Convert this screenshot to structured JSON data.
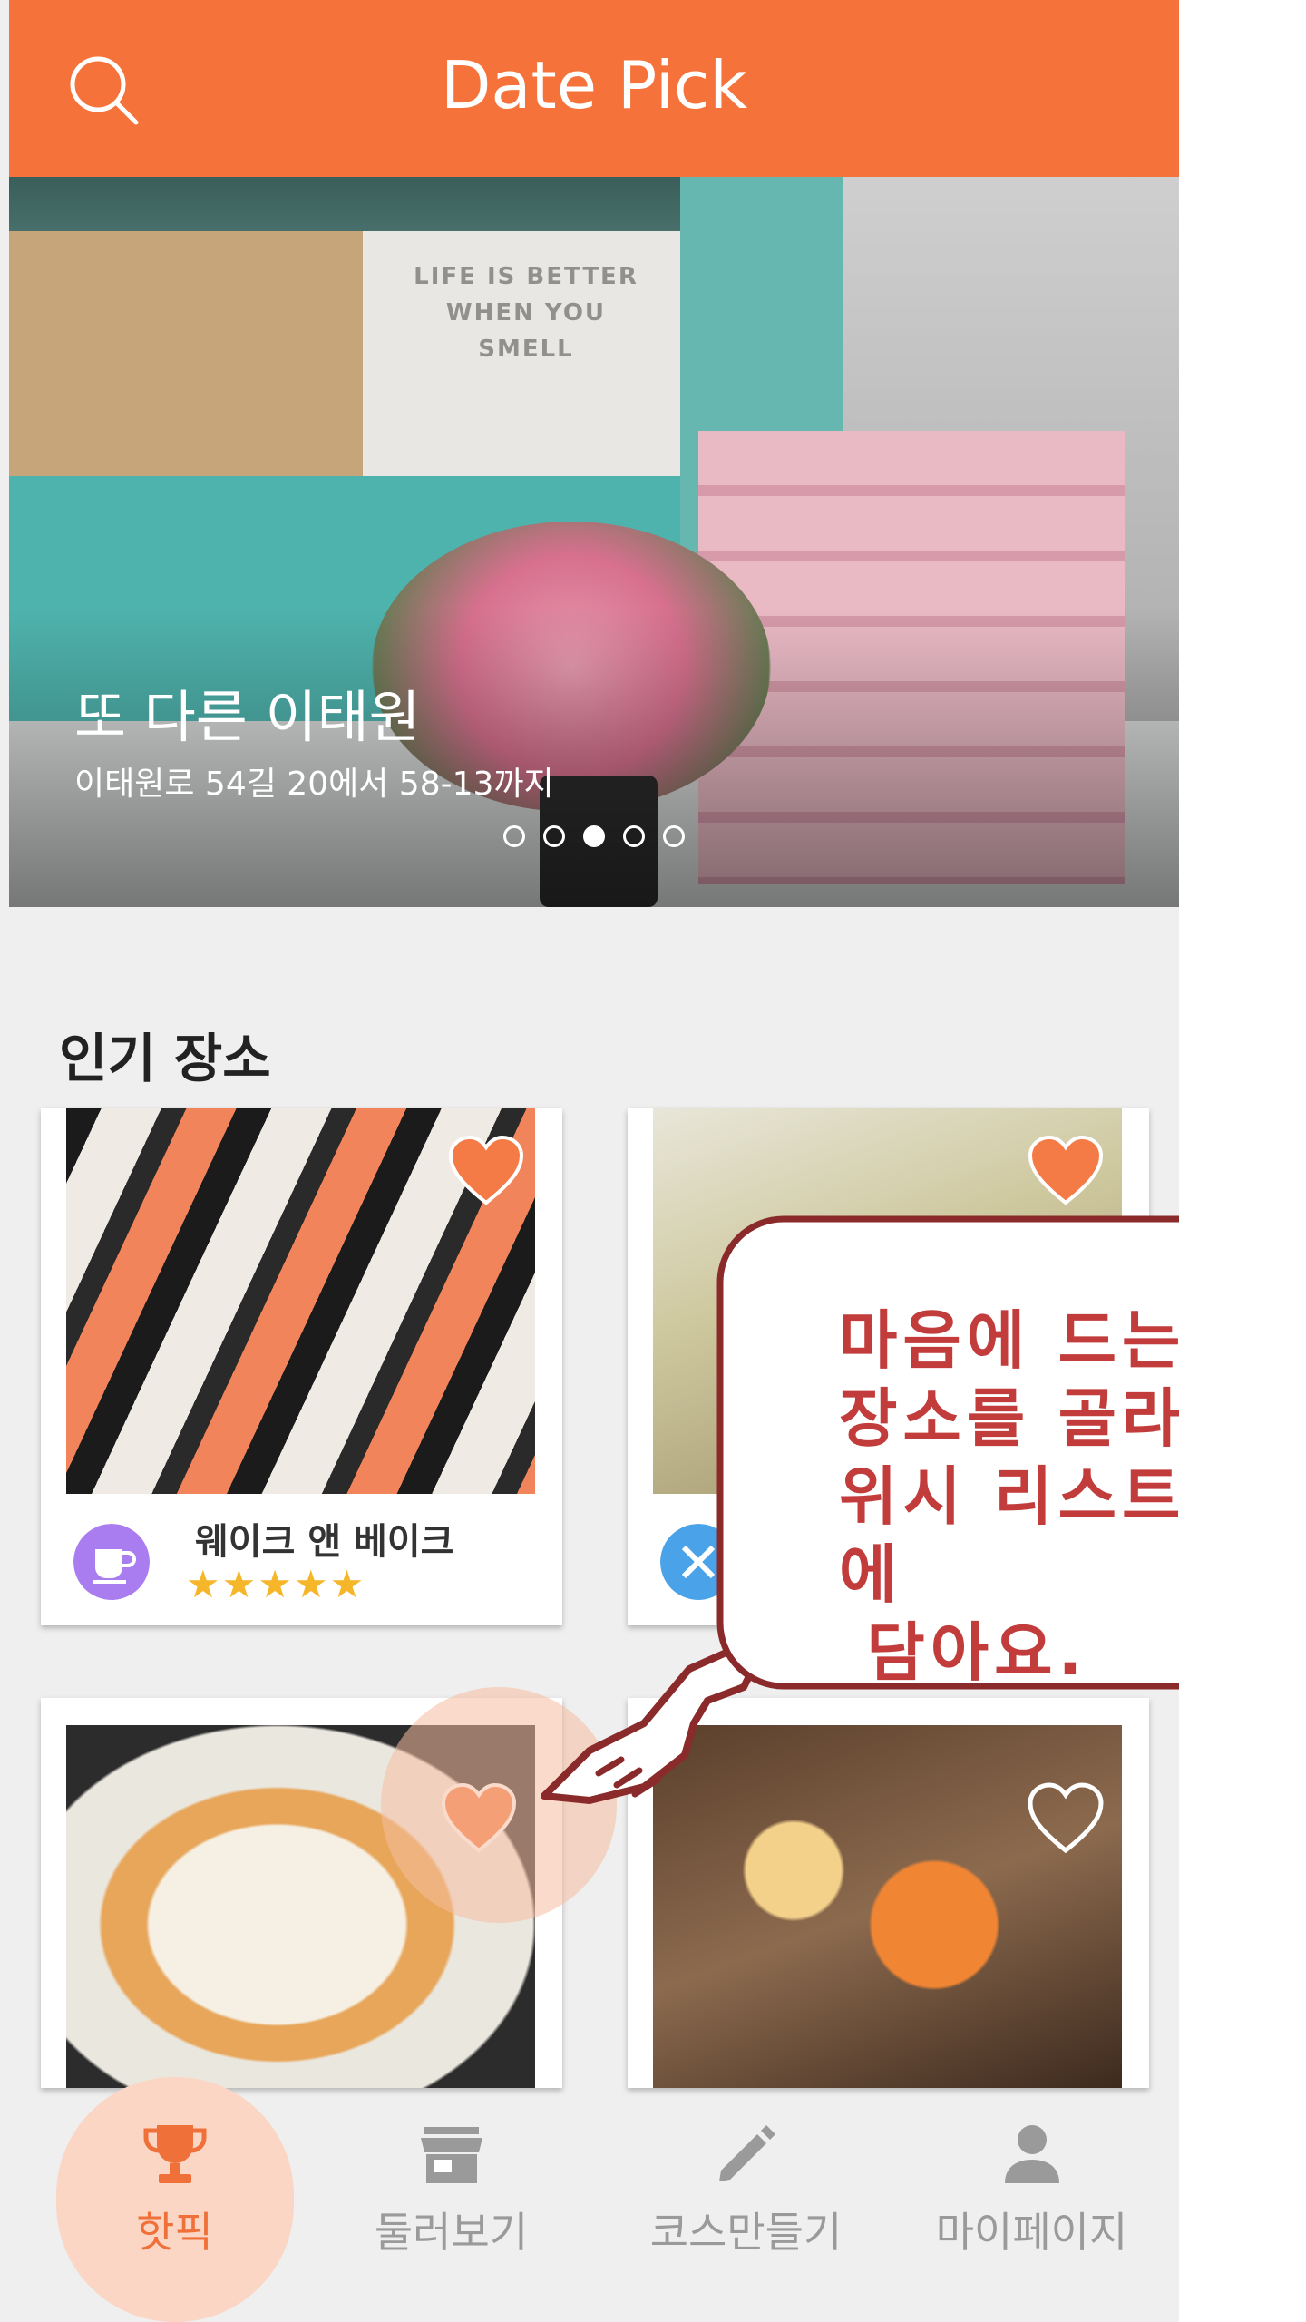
{
  "colors": {
    "primary": "#f5723b",
    "heart": "#f47a46",
    "callout_text": "#c23c3c",
    "callout_border": "#8b2a2a",
    "star": "#f6b62a",
    "nav_active_bg": "#fbd6c5"
  },
  "header": {
    "title": "Date Pick",
    "search_icon": "search-icon"
  },
  "hero": {
    "title": "또 다른 이태원",
    "subtitle": "이태원로 54길 20에서 58-13까지",
    "wordart": "LIFE IS BETTER WHEN YOU SMELL",
    "carousel": {
      "count": 5,
      "active_index": 3
    }
  },
  "popular": {
    "title": "인기 장소",
    "cards": [
      {
        "name": "웨이크 앤 베이크",
        "rating": 5,
        "stars": "★★★★★",
        "category_icon": "coffee-cup-icon"
      },
      {
        "category_icon": "fork-knife-icon"
      },
      {},
      {}
    ]
  },
  "callout": {
    "lines": [
      "마음에 드는",
      "장소를 골라",
      "위시 리스트에",
      " 담아요."
    ]
  },
  "bottom_nav": {
    "items": [
      {
        "label": "핫픽",
        "icon": "trophy-icon",
        "active": true
      },
      {
        "label": "둘러보기",
        "icon": "store-icon",
        "active": false
      },
      {
        "label": "코스만들기",
        "icon": "pencil-icon",
        "active": false
      },
      {
        "label": "마이페이지",
        "icon": "person-icon",
        "active": false
      }
    ]
  }
}
